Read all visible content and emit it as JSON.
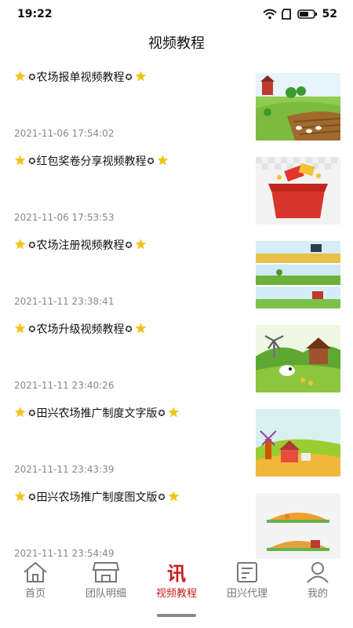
{
  "status": {
    "time": "19:22",
    "battery": "52"
  },
  "header": {
    "title": "视频教程"
  },
  "items": [
    {
      "title": "农场报单视频教程",
      "date": "2021-11-06 17:54:02"
    },
    {
      "title": "红包奖卷分享视频教程",
      "date": "2021-11-06 17:53:53"
    },
    {
      "title": "农场注册视频教程",
      "date": "2021-11-11 23:38:41"
    },
    {
      "title": "农场升级视频教程",
      "date": "2021-11-11 23:40:26"
    },
    {
      "title": "田兴农场推广制度文字版",
      "date": "2021-11-11 23:43:39"
    },
    {
      "title": "田兴农场推广制度图文版",
      "date": "2021-11-11 23:54:49"
    }
  ],
  "tabs": [
    {
      "label": "首页",
      "icon": "home-icon"
    },
    {
      "label": "团队明细",
      "icon": "shop-icon"
    },
    {
      "label": "视频教程",
      "icon": "news-icon",
      "active": true
    },
    {
      "label": "田兴代理",
      "icon": "document-icon"
    },
    {
      "label": "我的",
      "icon": "user-icon"
    }
  ],
  "colors": {
    "active": "#c81e1e",
    "inactive": "#777777",
    "star": "#f3c300"
  }
}
